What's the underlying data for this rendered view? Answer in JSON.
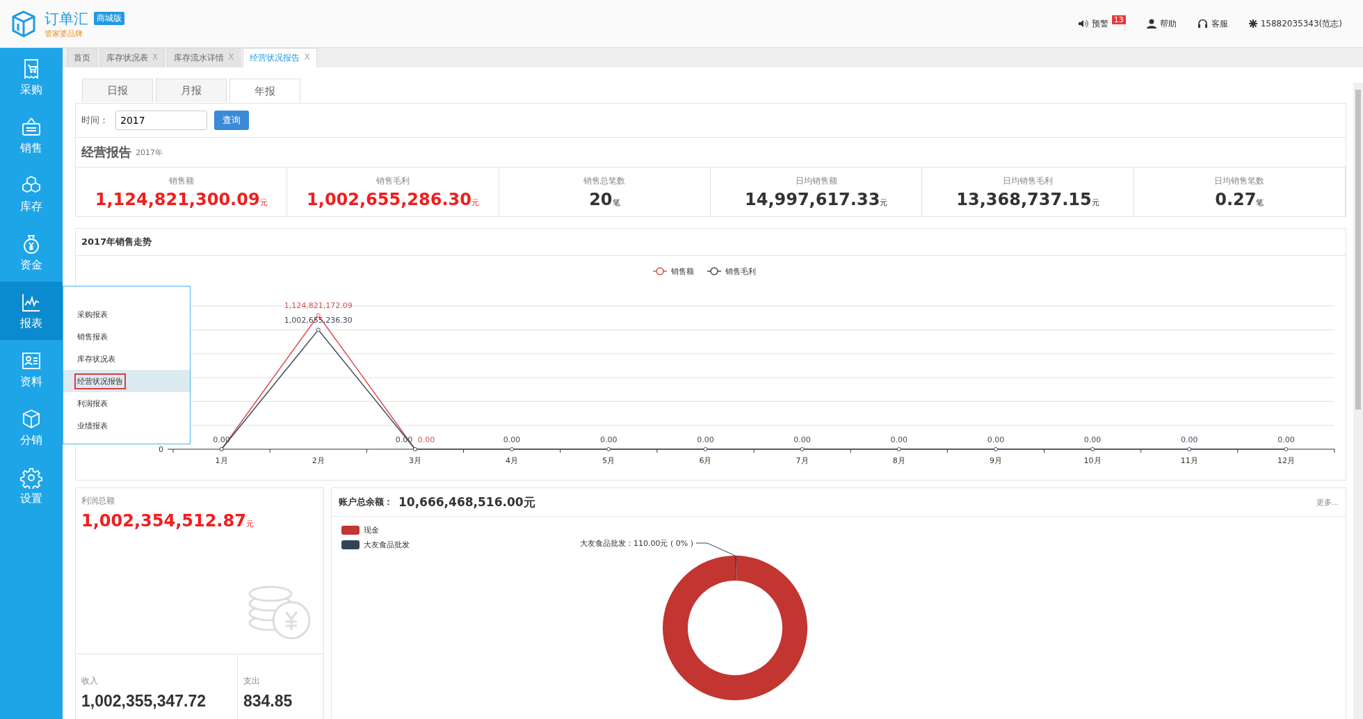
{
  "header": {
    "logo_title": "订单汇",
    "edition_badge": "商城版",
    "logo_subtitle": "管家婆品牌",
    "alerts": {
      "label": "预警",
      "count": "13"
    },
    "help": "帮助",
    "service": "客服",
    "account": "15882035343(范志)"
  },
  "sidebar": {
    "items": [
      {
        "label": "采购",
        "selected": false
      },
      {
        "label": "销售",
        "selected": false
      },
      {
        "label": "库存",
        "selected": false
      },
      {
        "label": "资金",
        "selected": false
      },
      {
        "label": "报表",
        "selected": true
      },
      {
        "label": "资料",
        "selected": false
      },
      {
        "label": "分销",
        "selected": false
      },
      {
        "label": "设置",
        "selected": false
      }
    ]
  },
  "flyout_menu": {
    "items": [
      {
        "label": "采购报表",
        "selected": false
      },
      {
        "label": "销售报表",
        "selected": false
      },
      {
        "label": "库存状况表",
        "selected": false
      },
      {
        "label": "经营状况报告",
        "selected": true
      },
      {
        "label": "利润报表",
        "selected": false
      },
      {
        "label": "业绩报表",
        "selected": false
      }
    ]
  },
  "page_tabs": [
    {
      "label": "首页",
      "selected": false
    },
    {
      "label": "库存状况表",
      "close": "X",
      "selected": false
    },
    {
      "label": "库存流水详情",
      "close": "X",
      "selected": false
    },
    {
      "label": "经营状况报告",
      "close": "X",
      "selected": true
    }
  ],
  "report_tabs": [
    {
      "label": "日报",
      "selected": false
    },
    {
      "label": "月报",
      "selected": false
    },
    {
      "label": "年报",
      "selected": true
    }
  ],
  "filter": {
    "label": "时间：",
    "value": "2017",
    "button": "查询"
  },
  "report": {
    "title": "经营报告",
    "subtitle": "2017年"
  },
  "kpis": [
    {
      "label": "销售额",
      "value": "1,124,821,300.09",
      "unit": "元",
      "highlight": true
    },
    {
      "label": "销售毛利",
      "value": "1,002,655,286.30",
      "unit": "元",
      "highlight": true
    },
    {
      "label": "销售总笔数",
      "value": "20",
      "unit": "笔",
      "highlight": false
    },
    {
      "label": "日均销售额",
      "value": "14,997,617.33",
      "unit": "元",
      "highlight": false
    },
    {
      "label": "日均销售毛利",
      "value": "13,368,737.15",
      "unit": "元",
      "highlight": false
    },
    {
      "label": "日均销售笔数",
      "value": "0.27",
      "unit": "笔",
      "highlight": false
    }
  ],
  "trend": {
    "title": "2017年销售走势",
    "chart_data": {
      "type": "line",
      "legend": "top",
      "categories": [
        "1月",
        "2月",
        "3月",
        "4月",
        "5月",
        "6月",
        "7月",
        "8月",
        "9月",
        "10月",
        "11月",
        "12月"
      ],
      "series": [
        {
          "name": "销售额",
          "color": "#d94f4f",
          "marker": "circle",
          "values": [
            0,
            1124821172.09,
            0,
            null,
            null,
            null,
            null,
            null,
            null,
            null,
            null,
            null
          ],
          "value_labels": [
            null,
            "1,124,821,172.09",
            "0.00",
            null,
            null,
            null,
            null,
            null,
            null,
            null,
            null,
            null
          ]
        },
        {
          "name": "销售毛利",
          "color": "#3d4a5a",
          "marker": "circle",
          "values": [
            0,
            1002655236.3,
            0,
            0,
            0,
            0,
            0,
            0,
            0,
            0,
            0,
            0
          ],
          "value_labels": [
            "0.00",
            "1,002,655,236.30",
            "0.00",
            "0.00",
            "0.00",
            "0.00",
            "0.00",
            "0.00",
            "0.00",
            "0.00",
            "0.00",
            "0.00"
          ]
        }
      ],
      "data_labels": "value_labels"
    },
    "y_axis_label": "0"
  },
  "profit": {
    "label": "利润总额",
    "value": "1,002,354,512.87",
    "unit": "元",
    "income_label": "收入",
    "income_value": "1,002,355,347.72",
    "expense_label": "支出",
    "expense_value": "834.85"
  },
  "accounts": {
    "label": "账户总余额：",
    "value": "10,666,468,516.00元",
    "more": "更多...",
    "slice_label": "大友食品批发：110.00元 ( 0% )",
    "legend": [
      {
        "label": "现金",
        "color": "#c23531"
      },
      {
        "label": "大友食品批发",
        "color": "#2f4554"
      }
    ]
  }
}
